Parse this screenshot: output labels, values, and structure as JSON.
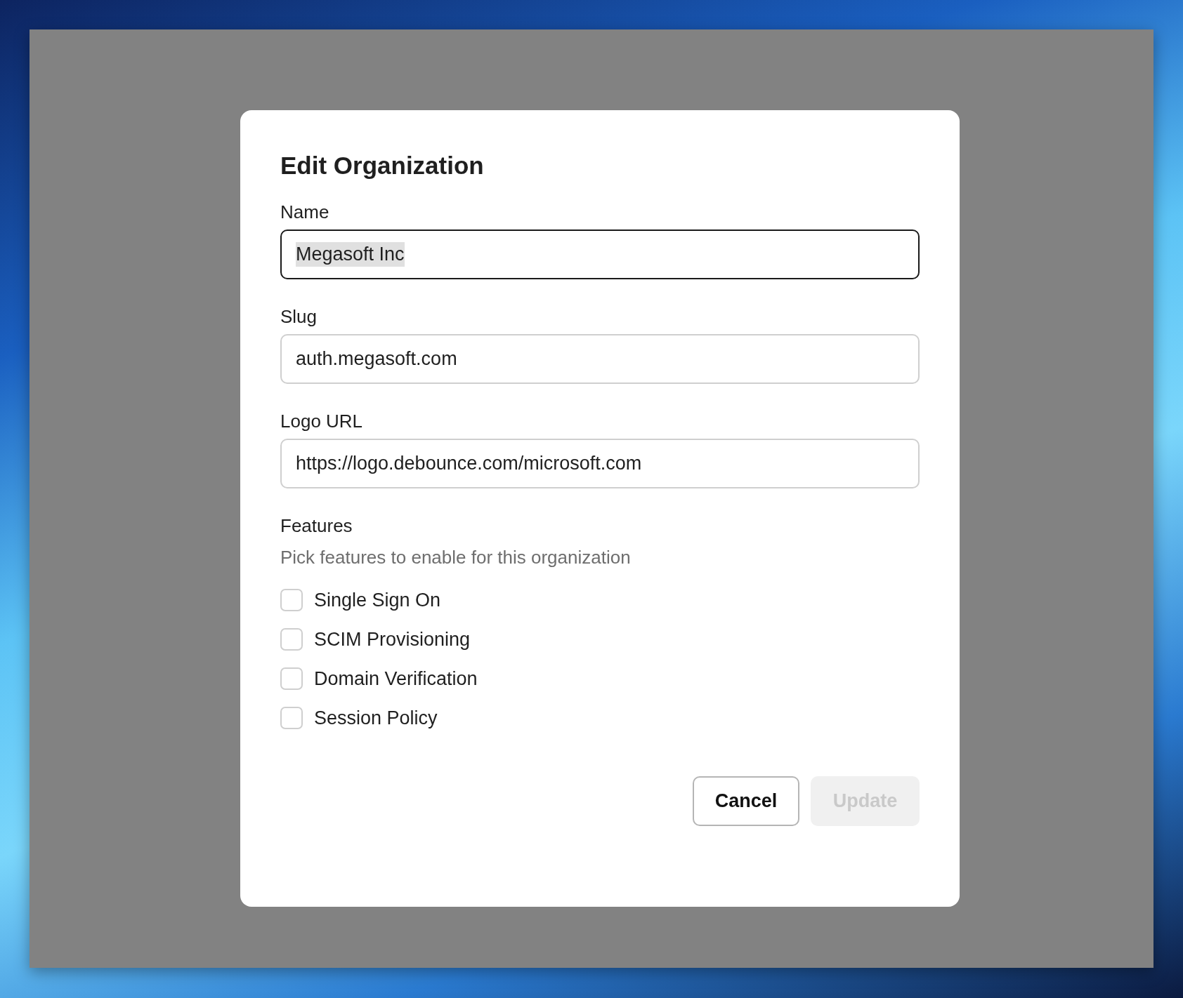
{
  "dialog": {
    "title": "Edit Organization",
    "fields": [
      {
        "label": "Name",
        "value": "Megasoft Inc",
        "focused": true,
        "value_selected": true
      },
      {
        "label": "Slug",
        "value": "auth.megasoft.com",
        "focused": false,
        "value_selected": false
      },
      {
        "label": "Logo URL",
        "value": "https://logo.debounce.com/microsoft.com",
        "focused": false,
        "value_selected": false
      }
    ],
    "features": {
      "heading": "Features",
      "description": "Pick features to enable for this organization",
      "options": [
        {
          "label": "Single Sign On",
          "checked": false
        },
        {
          "label": "SCIM Provisioning",
          "checked": false
        },
        {
          "label": "Domain Verification",
          "checked": false
        },
        {
          "label": "Session Policy",
          "checked": false
        }
      ]
    },
    "buttons": [
      {
        "label": "Cancel",
        "kind": "secondary",
        "disabled": false
      },
      {
        "label": "Update",
        "kind": "primary",
        "disabled": true
      }
    ]
  }
}
